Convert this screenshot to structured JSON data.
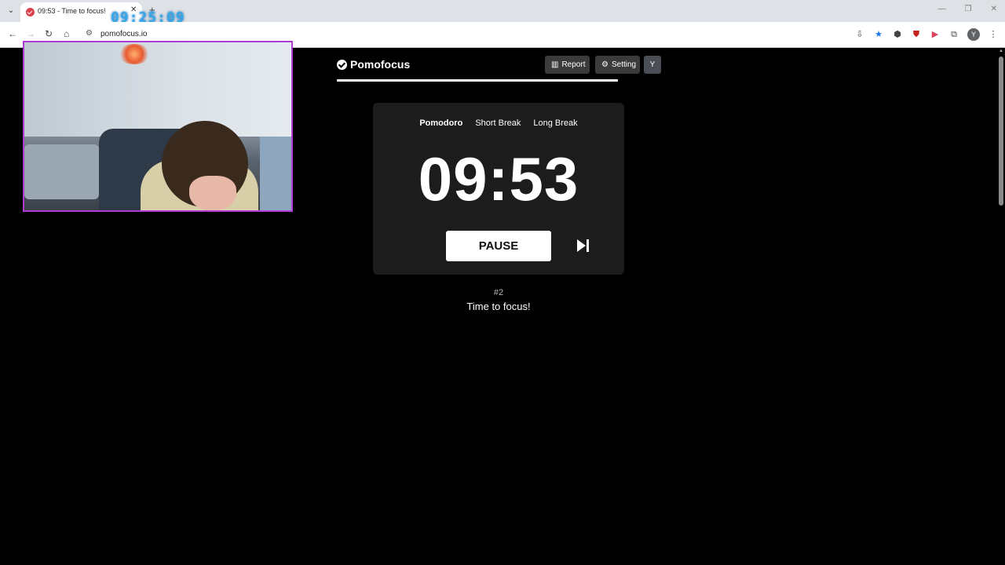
{
  "browser": {
    "tab_title": "09:53 - Time to focus!",
    "tab_close": "✕",
    "new_tab": "+",
    "overlay_clock": "09:25:09",
    "url": "pomofocus.io",
    "profile_initial": "Y",
    "window_controls": [
      "—",
      "❐",
      "✕"
    ]
  },
  "app": {
    "brand": "Pomofocus",
    "report_label": "Report",
    "setting_label": "Setting",
    "user_initial": "Y",
    "progress_fraction": 1.0,
    "modes": [
      {
        "label": "Pomodoro",
        "active": true
      },
      {
        "label": "Short Break",
        "active": false
      },
      {
        "label": "Long Break",
        "active": false
      }
    ],
    "timer": "09:53",
    "pause_label": "PAUSE",
    "round_number": "#2",
    "round_message": "Time to focus!"
  },
  "colors": {
    "background": "#000000",
    "card": "#1c1c1c",
    "webcam_border": "#b03ad4",
    "clock_overlay": "#38a8e8"
  }
}
